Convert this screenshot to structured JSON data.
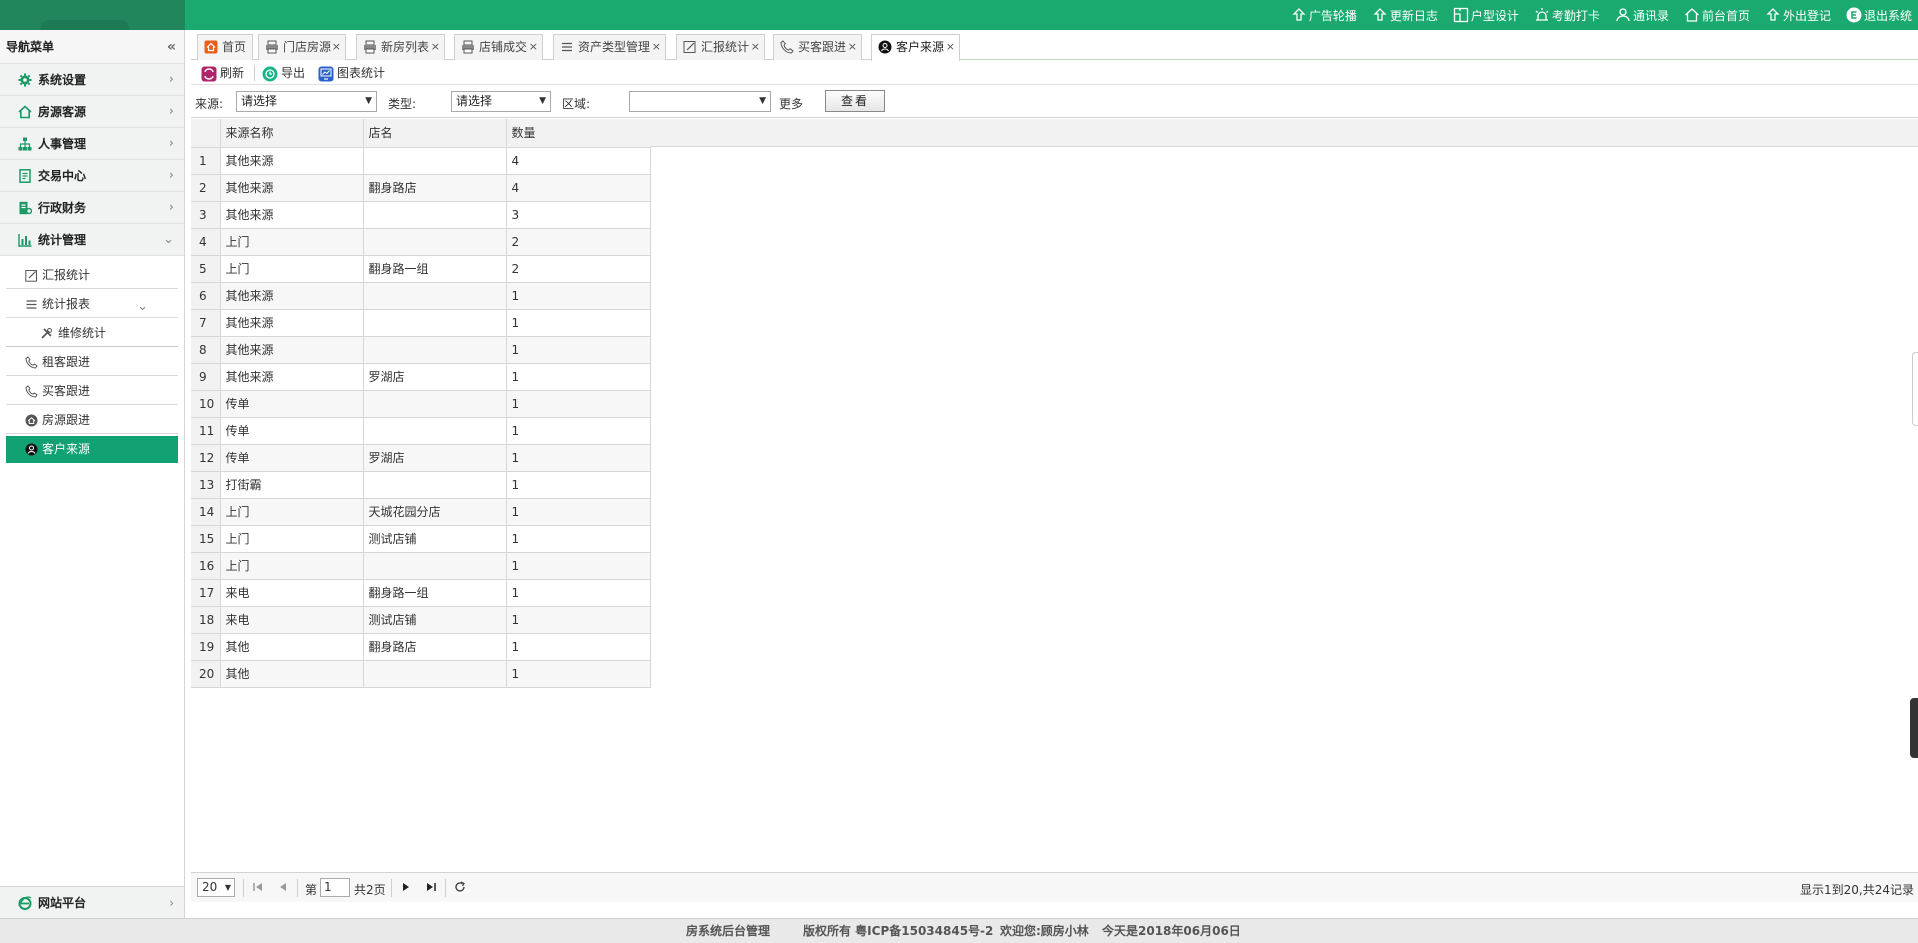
{
  "top_links": [
    {
      "label": "广告轮播",
      "icon": "upload-icon"
    },
    {
      "label": "更新日志",
      "icon": "upload-icon"
    },
    {
      "label": "户型设计",
      "icon": "floorplan-icon"
    },
    {
      "label": "考勤打卡",
      "icon": "alarm-icon"
    },
    {
      "label": "通讯录",
      "icon": "contacts-icon"
    },
    {
      "label": "前台首页",
      "icon": "home-icon"
    },
    {
      "label": "外出登记",
      "icon": "upload-icon"
    },
    {
      "label": "退出系统",
      "icon": "logout-icon"
    }
  ],
  "sidebar": {
    "title": "导航菜单",
    "menus": [
      {
        "label": "系统设置",
        "icon": "gear-icon"
      },
      {
        "label": "房源客源",
        "icon": "house-icon"
      },
      {
        "label": "人事管理",
        "icon": "org-chart-icon"
      },
      {
        "label": "交易中心",
        "icon": "document-icon"
      },
      {
        "label": "行政财务",
        "icon": "finance-icon"
      },
      {
        "label": "统计管理",
        "icon": "bar-chart-icon"
      }
    ],
    "sub_items": [
      {
        "label": "汇报统计",
        "icon": "edit-icon"
      },
      {
        "label": "统计报表",
        "icon": "list-icon"
      },
      {
        "label": "维修统计",
        "icon": "tools-icon"
      },
      {
        "label": "租客跟进",
        "icon": "phone-icon"
      },
      {
        "label": "买客跟进",
        "icon": "phone-icon"
      },
      {
        "label": "房源跟进",
        "icon": "house-circle-icon"
      },
      {
        "label": "客户来源",
        "icon": "user-circle-icon"
      }
    ],
    "bottom": {
      "label": "网站平台",
      "icon": "ie-icon"
    }
  },
  "tabs": [
    {
      "label": "首页",
      "icon": "home-icon",
      "closable": false
    },
    {
      "label": "门店房源",
      "icon": "printer-icon",
      "closable": true
    },
    {
      "label": "新房列表",
      "icon": "printer-icon",
      "closable": true
    },
    {
      "label": "店铺成交",
      "icon": "printer-icon",
      "closable": true
    },
    {
      "label": "资产类型管理",
      "icon": "list-icon",
      "closable": true
    },
    {
      "label": "汇报统计",
      "icon": "edit-icon",
      "closable": true
    },
    {
      "label": "买客跟进",
      "icon": "phone-icon",
      "closable": true
    },
    {
      "label": "客户来源",
      "icon": "user-circle-icon",
      "closable": true
    }
  ],
  "toolbar": {
    "refresh": "刷新",
    "export": "导出",
    "chart_stats": "图表统计"
  },
  "filters": {
    "source_label": "来源:",
    "source_value": "请选择",
    "type_label": "类型:",
    "type_value": "请选择",
    "region_label": "区域:",
    "region_value": "",
    "more": "更多",
    "view_button": "查看"
  },
  "table": {
    "columns": [
      "来源名称",
      "店名",
      "数量"
    ],
    "rows": [
      [
        "1",
        "其他来源",
        "",
        "4"
      ],
      [
        "2",
        "其他来源",
        "翻身路店",
        "4"
      ],
      [
        "3",
        "其他来源",
        "",
        "3"
      ],
      [
        "4",
        "上门",
        "",
        "2"
      ],
      [
        "5",
        "上门",
        "翻身路一组",
        "2"
      ],
      [
        "6",
        "其他来源",
        "",
        "1"
      ],
      [
        "7",
        "其他来源",
        "",
        "1"
      ],
      [
        "8",
        "其他来源",
        "",
        "1"
      ],
      [
        "9",
        "其他来源",
        "罗湖店",
        "1"
      ],
      [
        "10",
        "传单",
        "",
        "1"
      ],
      [
        "11",
        "传单",
        "",
        "1"
      ],
      [
        "12",
        "传单",
        "罗湖店",
        "1"
      ],
      [
        "13",
        "打街霸",
        "",
        "1"
      ],
      [
        "14",
        "上门",
        "天城花园分店",
        "1"
      ],
      [
        "15",
        "上门",
        "测试店铺",
        "1"
      ],
      [
        "16",
        "上门",
        "",
        "1"
      ],
      [
        "17",
        "来电",
        "翻身路一组",
        "1"
      ],
      [
        "18",
        "来电",
        "测试店铺",
        "1"
      ],
      [
        "19",
        "其他",
        "翻身路店",
        "1"
      ],
      [
        "20",
        "其他",
        "",
        "1"
      ]
    ]
  },
  "pager": {
    "page_size": "20",
    "page_prefix": "第",
    "page_current": "1",
    "page_total": "共2页",
    "info": "显示1到20,共24记录"
  },
  "footer": {
    "system": "房系统后台管理",
    "copyright": "版权所有 粤ICP备15034845号-2",
    "welcome": "欢迎您:顾房小林",
    "date": "今天是2018年06月06日"
  },
  "colors": {
    "brand_green": "#1aa96f",
    "active_item": "#12a173"
  }
}
